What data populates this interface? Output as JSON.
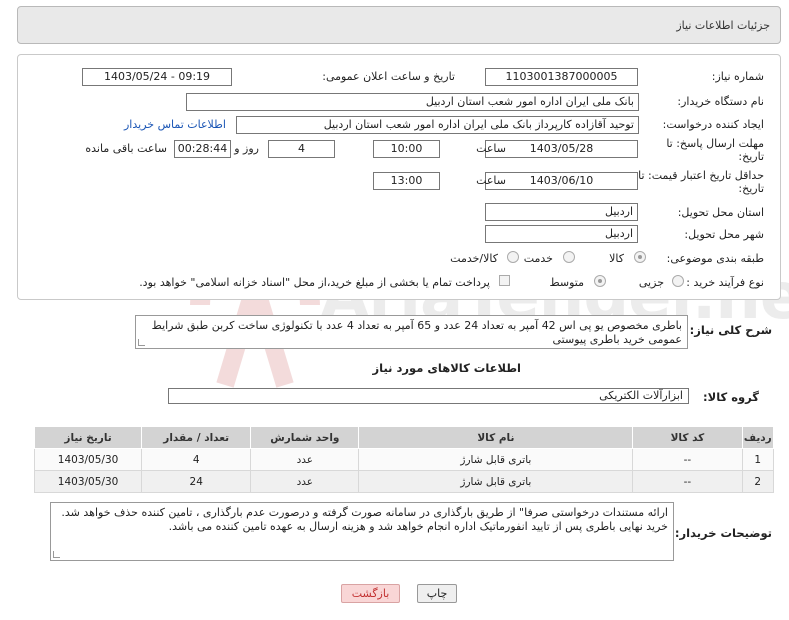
{
  "header": {
    "title": "جزئیات اطلاعات نیاز"
  },
  "form": {
    "need_number_label": "شماره نیاز:",
    "need_number": "1103001387000005",
    "announce_label": "تاریخ و ساعت اعلان عمومی:",
    "announce_value": "1403/05/24 - 09:19",
    "buyer_org_label": "نام دستگاه خریدار:",
    "buyer_org": "بانک ملی ایران اداره امور شعب استان اردبیل",
    "creator_label": "ایجاد کننده درخواست:",
    "creator": "توحید آقازاده کارپرداز بانک ملی ایران اداره امور شعب استان اردبیل",
    "contact_link": "اطلاعات تماس خریدار",
    "deadline_label_1": "مهلت ارسال پاسخ: تا",
    "deadline_label_2": "تاریخ:",
    "deadline_date": "1403/05/28",
    "time_label": "ساعت",
    "deadline_time": "10:00",
    "days_value": "4",
    "days_label": "روز و",
    "remaining_time": "00:28:44",
    "remaining_label": "ساعت باقی مانده",
    "validity_label_1": "حداقل تاریخ اعتبار قیمت: تا",
    "validity_label_2": "تاریخ:",
    "validity_date": "1403/06/10",
    "validity_time": "13:00",
    "province_label": "استان محل تحویل:",
    "province": "اردبیل",
    "city_label": "شهر محل تحویل:",
    "city": "اردبیل",
    "category_label": "طبقه بندی موضوعی:",
    "category_options": [
      "کالا",
      "خدمت",
      "کالا/خدمت"
    ],
    "process_label": "نوع فرآیند خرید :",
    "process_options": [
      "جزیی",
      "متوسط"
    ],
    "payment_note": "پرداخت تمام یا بخشی از مبلغ خرید،از محل \"اسناد خزانه اسلامی\" خواهد بود."
  },
  "description": {
    "label": "شرح کلی نیاز:",
    "text": "باطری مخصوص یو پی اس 42 آمپر به تعداد 24 عدد و 65 آمپر به تعداد 4 عدد با تکنولوژی ساخت کربن طبق شرایط عمومی خرید باطری پیوستی"
  },
  "goods": {
    "section_title": "اطلاعات کالاهای مورد نیاز",
    "group_label": "گروه کالا:",
    "group_value": "ابزارآلات الکتریکی",
    "columns": [
      "ردیف",
      "کد کالا",
      "نام کالا",
      "واحد شمارش",
      "تعداد / مقدار",
      "تاریخ نیاز"
    ],
    "rows": [
      {
        "index": "1",
        "code": "--",
        "name": "باتری قابل شارژ",
        "unit": "عدد",
        "qty": "4",
        "date": "1403/05/30"
      },
      {
        "index": "2",
        "code": "--",
        "name": "باتری قابل شارژ",
        "unit": "عدد",
        "qty": "24",
        "date": "1403/05/30"
      }
    ]
  },
  "buyer_notes": {
    "label": "توضیحات خریدار:",
    "line1": "ارائه مستندات درخواستی صرفا\" از طریق بارگذاری در سامانه صورت گرفته و درصورت عدم بارگذاری ، تامین کننده حذف خواهد شد.",
    "line2": "خرید نهایی باطری پس از تایید انفورماتیک اداره انجام خواهد شد و هزینه ارسال به عهده تامین کننده می باشد."
  },
  "buttons": {
    "print": "چاپ",
    "back": "بازگشت"
  },
  "watermark": {
    "text": "AriaTender.net"
  }
}
